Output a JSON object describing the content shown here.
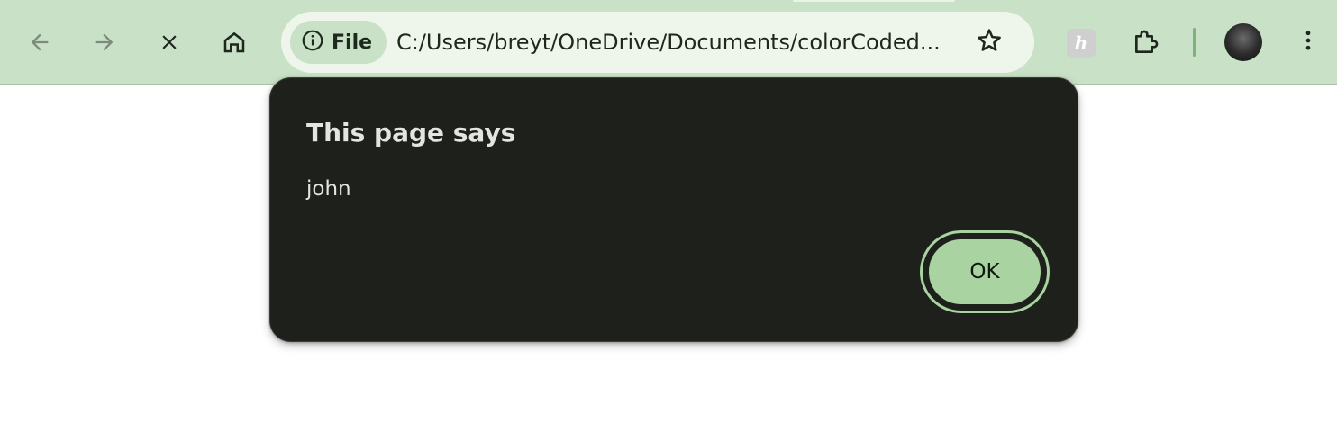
{
  "browser": {
    "chip_label": "File",
    "url": "C:/Users/breyt/OneDrive/Documents/colorCoded...",
    "icons": {
      "back": "arrow-left-icon",
      "forward": "arrow-right-icon",
      "stop": "close-icon",
      "home": "home-icon",
      "site_info": "info-icon",
      "bookmark": "star-icon",
      "extension_letter": "ℎ",
      "extensions": "puzzle-icon",
      "menu": "more-vertical-icon"
    },
    "colors": {
      "toolbar": "#c9e1c6",
      "omnibox": "#eef6ec",
      "accent": "#a9d3a0"
    }
  },
  "dialog": {
    "title": "This page says",
    "message": "john",
    "ok_label": "OK",
    "colors": {
      "background": "#1e201c",
      "text": "#e3e6df",
      "button": "#a9d3a0"
    }
  }
}
